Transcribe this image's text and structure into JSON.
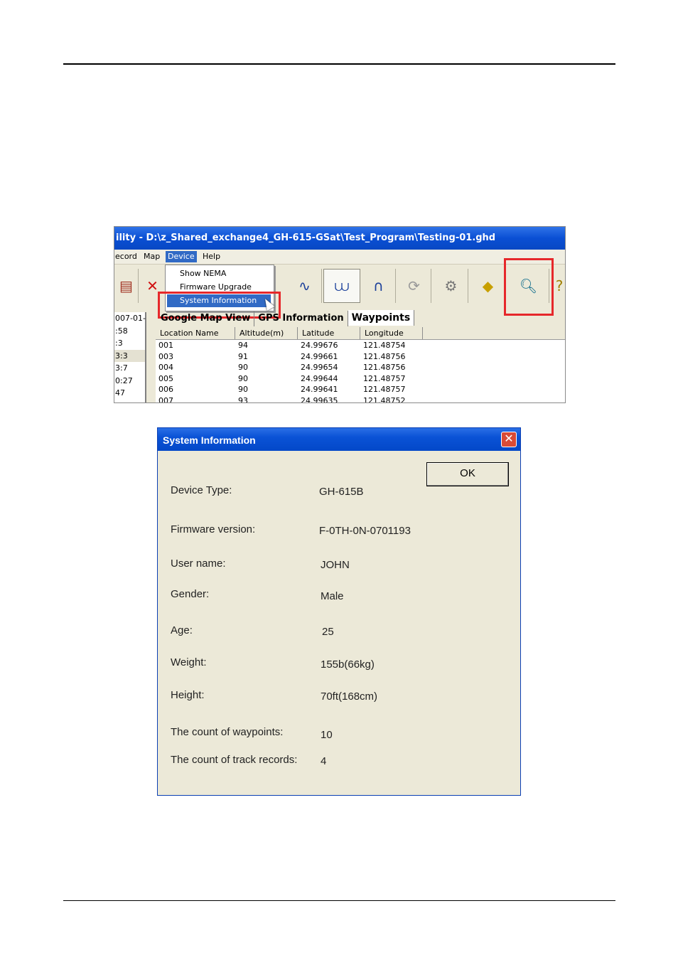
{
  "app": {
    "title": "ility - D:\\z_Shared_exchange4_GH-615-GSat\\Test_Program\\Testing-01.ghd",
    "menu": [
      "ecord",
      "Map",
      "Device",
      "Help"
    ],
    "device_menu": [
      "Show NEMA",
      "Firmware Upgrade",
      "System Information"
    ],
    "tabs": [
      "Google Map View",
      "GPS Information",
      "Waypoints"
    ],
    "left_list": [
      "007-01-",
      ":58",
      ":3",
      "3:3",
      "3:7",
      "0:27",
      "47"
    ],
    "table": {
      "headers": [
        "Location Name",
        "Altitude(m)",
        "Latitude",
        "Longitude"
      ],
      "rows": [
        [
          "001",
          "94",
          "24.99676",
          "121.48754"
        ],
        [
          "003",
          "91",
          "24.99661",
          "121.48756"
        ],
        [
          "004",
          "90",
          "24.99654",
          "121.48756"
        ],
        [
          "005",
          "90",
          "24.99644",
          "121.48757"
        ],
        [
          "006",
          "90",
          "24.99641",
          "121.48757"
        ],
        [
          "007",
          "93",
          "24.99635",
          "121.48752"
        ]
      ]
    },
    "highlight_color": "#e6282b"
  },
  "dialog": {
    "title": "System Information",
    "close_glyph": "✕",
    "ok_label": "OK",
    "fields": [
      {
        "label": "Device Type:",
        "value": "GH-615B"
      },
      {
        "label": "Firmware version:",
        "value": "F-0TH-0N-0701193"
      },
      {
        "label": "User name:",
        "value": "JOHN"
      },
      {
        "label": "Gender:",
        "value": "Male"
      },
      {
        "label": "Age:",
        "value": "25"
      },
      {
        "label": "Weight:",
        "value": "155b(66kg)"
      },
      {
        "label": "Height:",
        "value": "70ft(168cm)"
      },
      {
        "label": "The count of waypoints:",
        "value": "10"
      },
      {
        "label": "The count of track records:",
        "value": "4"
      }
    ]
  }
}
